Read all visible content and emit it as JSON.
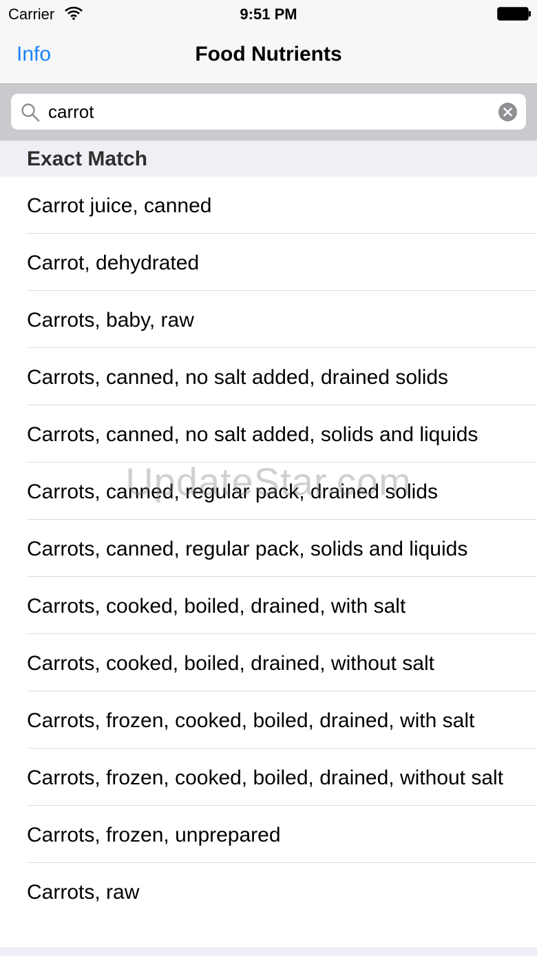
{
  "status_bar": {
    "carrier": "Carrier",
    "time": "9:51 PM"
  },
  "nav": {
    "left_button": "Info",
    "title": "Food Nutrients"
  },
  "search": {
    "value": "carrot"
  },
  "section": {
    "label": "Exact Match"
  },
  "results": [
    "Carrot juice, canned",
    "Carrot, dehydrated",
    "Carrots, baby, raw",
    "Carrots, canned, no salt added, drained solids",
    "Carrots, canned, no salt added, solids and liquids",
    "Carrots, canned, regular pack, drained solids",
    "Carrots, canned, regular pack, solids and liquids",
    "Carrots, cooked, boiled, drained, with salt",
    "Carrots, cooked, boiled, drained, without salt",
    "Carrots, frozen, cooked, boiled, drained, with salt",
    "Carrots, frozen, cooked, boiled, drained, without salt",
    "Carrots, frozen, unprepared",
    "Carrots, raw"
  ],
  "watermark": "UpdateStar.com",
  "colors": {
    "accent": "#1a82fb",
    "search_bar_bg": "#c9c9ce",
    "section_bg": "#f0eff5"
  }
}
